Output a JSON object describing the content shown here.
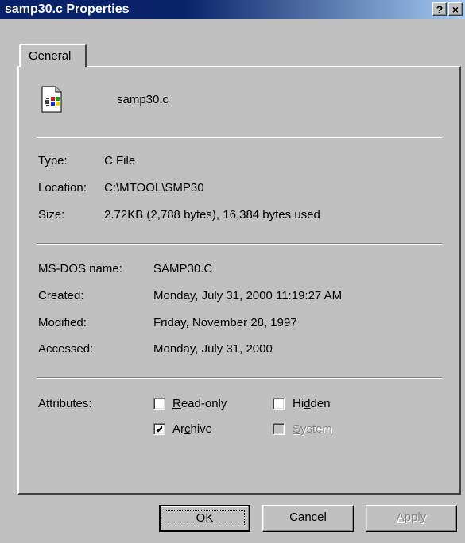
{
  "window": {
    "title": "samp30.c Properties",
    "help_glyph": "?",
    "close_glyph": "×"
  },
  "tabs": [
    {
      "label": "General",
      "active": true
    }
  ],
  "file": {
    "name": "samp30.c",
    "icon": "c-file-icon"
  },
  "info": {
    "type_label": "Type:",
    "type_value": "C File",
    "location_label": "Location:",
    "location_value": "C:\\MTOOL\\SMP30",
    "size_label": "Size:",
    "size_value": "2.72KB (2,788 bytes), 16,384 bytes used"
  },
  "dates": {
    "msdos_label": "MS-DOS name:",
    "msdos_value": "SAMP30.C",
    "created_label": "Created:",
    "created_value": "Monday, July 31, 2000 11:19:27 AM",
    "modified_label": "Modified:",
    "modified_value": "Friday, November 28, 1997",
    "accessed_label": "Accessed:",
    "accessed_value": "Monday, July 31, 2000"
  },
  "attributes": {
    "label": "Attributes:",
    "readonly": {
      "prefix": "",
      "accel": "R",
      "rest": "ead-only",
      "checked": false,
      "enabled": true
    },
    "hidden": {
      "prefix": "Hi",
      "accel": "d",
      "rest": "den",
      "checked": false,
      "enabled": true
    },
    "archive": {
      "prefix": "Ar",
      "accel": "c",
      "rest": "hive",
      "checked": true,
      "enabled": true
    },
    "system": {
      "prefix": "",
      "accel": "S",
      "rest": "ystem",
      "checked": false,
      "enabled": false
    }
  },
  "buttons": {
    "ok": "OK",
    "cancel": "Cancel",
    "apply_accel": "A",
    "apply_rest": "pply"
  },
  "colors": {
    "title_start": "#0a246a",
    "title_end": "#a6caf0",
    "face": "#c0c0c0"
  }
}
